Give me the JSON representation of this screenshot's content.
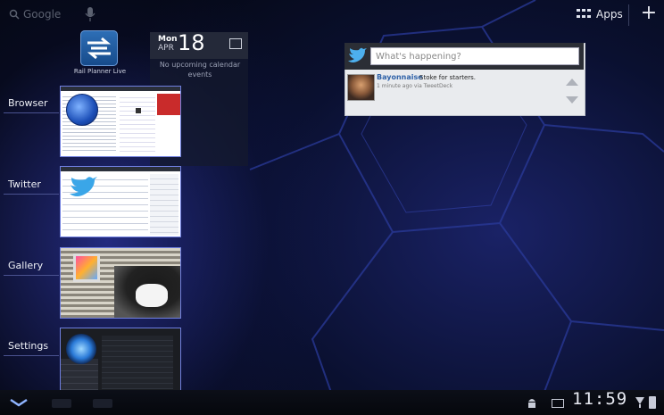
{
  "top_bar": {
    "search_label": "Google",
    "apps_label": "Apps"
  },
  "home": {
    "rail_planner_label": "Rail Planner Live"
  },
  "calendar_widget": {
    "day_name": "Mon",
    "month": "APR",
    "day_number": "18",
    "empty_text": "No upcoming calendar events"
  },
  "recent_apps": [
    {
      "label": "Browser"
    },
    {
      "label": "Twitter"
    },
    {
      "label": "Gallery"
    },
    {
      "label": "Settings"
    }
  ],
  "twitter_widget": {
    "input_placeholder": "What's happening?",
    "tweet": {
      "user": "Bayonnaise",
      "text": "Stoke for starters.",
      "meta": "1 minute ago via TweetDeck"
    }
  },
  "status_bar": {
    "clock": "11:59"
  },
  "colors": {
    "twitter_name": "#2f62a8",
    "thumb_border": "#6f7fe0"
  }
}
